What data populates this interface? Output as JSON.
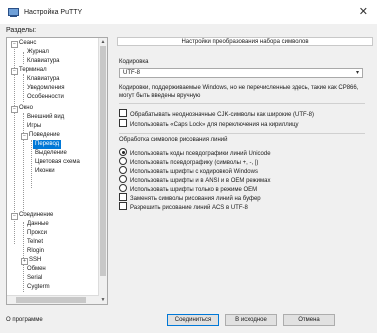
{
  "window": {
    "title": "Настройка PuTTY"
  },
  "category_label": "Разделы:",
  "tree": [
    {
      "label": "Сеанс"
    },
    {
      "label": "Журнал"
    },
    {
      "label": "Клавиатура"
    },
    {
      "label": "Терминал"
    },
    {
      "label": "Клавиатура"
    },
    {
      "label": "Уведомления"
    },
    {
      "label": "Особенности"
    },
    {
      "label": "Окно"
    },
    {
      "label": "Внешний вид"
    },
    {
      "label": "Игры"
    },
    {
      "label": "Поведение"
    },
    {
      "label": "Перевод"
    },
    {
      "label": "Выделение"
    },
    {
      "label": "Цветовая схема"
    },
    {
      "label": "Иконки"
    },
    {
      "label": "Соединение"
    },
    {
      "label": "Данные"
    },
    {
      "label": "Прокси"
    },
    {
      "label": "Telnet"
    },
    {
      "label": "Rlogin"
    },
    {
      "label": "SSH"
    },
    {
      "label": "Обмен"
    },
    {
      "label": "Serial"
    },
    {
      "label": "Cygterm"
    }
  ],
  "panel": {
    "banner": "Настройки преобразования набора символов",
    "encoding_label": "Кодировка",
    "encoding_value": "UTF-8",
    "encoding_note": "Кодировки, поддерживаемые Windows, но не перечисленные здесь, такие как CP866, могут быть введены вручную",
    "checks_top": [
      {
        "label": "Обрабатывать неоднозначные CJK-символы как широкие (UTF-8)",
        "checked": false
      },
      {
        "label": "Использовать «Caps Lock» для переключения на кириллицу",
        "checked": false
      }
    ],
    "line_drawing_label": "Обработка символов рисования линий",
    "radios": [
      {
        "label": "Использовать коды псевдографики линий Unicode",
        "checked": true
      },
      {
        "label": "Использовать псевдографику (символы +, -, |)",
        "checked": false
      },
      {
        "label": "Использовать шрифты с кодировкой Windows",
        "checked": false
      },
      {
        "label": "Использовать шрифты и в ANSI и в OEM режимах",
        "checked": false
      },
      {
        "label": "Использовать шрифты только в режиме OEM",
        "checked": false
      }
    ],
    "checks_bottom": [
      {
        "label": "Заменять символы рисования линий на буфер",
        "checked": false
      },
      {
        "label": "Разрешить рисование линий ACS в UTF-8",
        "checked": false
      }
    ]
  },
  "buttons": {
    "about": "О программе",
    "connect": "Соединиться",
    "default": "В исходное",
    "cancel": "Отмена"
  }
}
